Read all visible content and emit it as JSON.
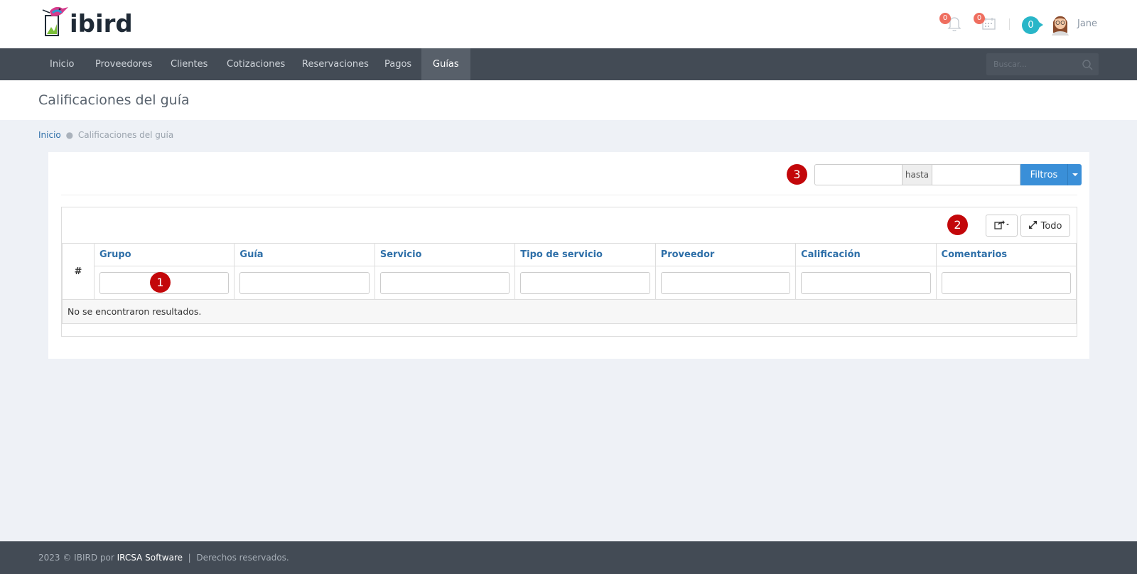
{
  "brand": {
    "logo_text": "ibird"
  },
  "header": {
    "notifications_count": "0",
    "calendar_count": "0",
    "chat_count": "0",
    "username": "Jane"
  },
  "nav": {
    "items": [
      {
        "label": "Inicio"
      },
      {
        "label": "Proveedores"
      },
      {
        "label": "Clientes"
      },
      {
        "label": "Cotizaciones"
      },
      {
        "label": "Reservaciones"
      },
      {
        "label": "Pagos"
      },
      {
        "label": "Guías",
        "active": true
      }
    ],
    "search_placeholder": "Buscar..."
  },
  "page": {
    "title": "Calificaciones del guía",
    "breadcrumb": {
      "home": "Inicio",
      "current": "Calificaciones del guía"
    }
  },
  "filters": {
    "from_value": "",
    "to_label": "hasta",
    "to_value": "",
    "button_label": "Filtros"
  },
  "markers": [
    "1",
    "2",
    "3"
  ],
  "table": {
    "toolbar": {
      "fullscreen_label": "Todo"
    },
    "columns": [
      "#",
      "Grupo",
      "Guía",
      "Servicio",
      "Tipo de servicio",
      "Proveedor",
      "Calificación",
      "Comentarios"
    ],
    "empty_message": "No se encontraron resultados."
  },
  "footer": {
    "prefix": "2023 © IBIRD por",
    "company": "IRCSA Software",
    "separator": "|",
    "rights": "Derechos reservados."
  },
  "colors": {
    "nav_bg": "#434b55",
    "primary": "#3a8fd8",
    "link": "#2e6fa8",
    "marker": "#c3070a",
    "badge": "#ef6e5f",
    "chat": "#29b6c8"
  }
}
